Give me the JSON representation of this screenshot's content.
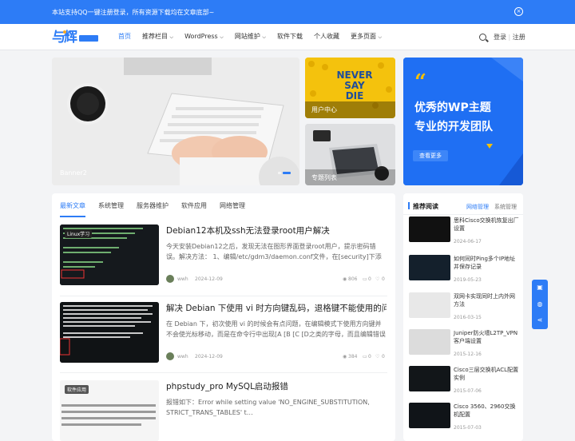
{
  "topbar": {
    "message": "本站支持QQ一键注册登录，所有资源下载均在文章底部~",
    "close_icon": "×"
  },
  "nav": {
    "items": [
      "首页",
      "推荐栏目",
      "WordPress",
      "网站维护",
      "软件下载",
      "个人收藏",
      "更多页面"
    ],
    "login": "登录",
    "register": "注册",
    "separator": "|"
  },
  "slider": {
    "caption": "Banner2"
  },
  "tiles": [
    {
      "caption": "用户中心",
      "poster": [
        "NEVER",
        "SAY",
        "DIE"
      ]
    },
    {
      "caption": "专题列表"
    }
  ],
  "ad": {
    "line1": "优秀的WP主题",
    "line2": "专业的开发团队",
    "button": "查看更多",
    "quote": "“"
  },
  "tabs": [
    "最新文章",
    "系统管理",
    "服务器维护",
    "软件应用",
    "网络管理"
  ],
  "posts": [
    {
      "title": "Debian12本机及ssh无法登录root用户解决",
      "excerpt": "今天安装Debian12之后，发现无法在图形界面登录root用户，提示密码错误。解决方法： 1、编辑/etc/gdm3/daemon.conf文件，在[security]下添加A…",
      "author": "wwh",
      "date": "2024-12-09",
      "views": "806",
      "comments": "0",
      "likes": "0",
      "badge": "Linux学习"
    },
    {
      "title": "解决 Debian 下使用 vi 时方向键乱码，退格键不能使用的问题",
      "excerpt": "在 Debian 下，初次使用 vi 的时候会有点问题，在编辑模式下使用方向键并不会使光标移动，而是在命令行中出现[A [B [C [D之类的字母，而且编辑错误的…",
      "author": "wwh",
      "date": "2024-12-09",
      "views": "384",
      "comments": "0",
      "likes": "0"
    },
    {
      "title": "phpstudy_pro MySQL启动报错",
      "excerpt": "报错如下：Error while setting value  'NO_ENGINE_SUBSTITUTION, STRICT_TRANS_TABLES'  t…",
      "badge": "软件应用"
    }
  ],
  "sidebar": {
    "title": "推荐阅读",
    "tab_active": "网络管理",
    "tab2": "系统管理",
    "items": [
      {
        "title": "思科Cisco交换机恢复出厂设置",
        "date": "2024-06-17"
      },
      {
        "title": "如何同时Ping多个IP地址并保存记录",
        "date": "2019-05-23"
      },
      {
        "title": "双网卡实现同时上内外网方法",
        "date": "2016-03-15"
      },
      {
        "title": "Juniper防火墙L2TP_VPN客户端设置",
        "date": "2015-12-16"
      },
      {
        "title": "Cisco三层交换机ACL配置实例",
        "date": "2015-07-06"
      },
      {
        "title": "Cisco 3560、2960交换机配置",
        "date": "2015-07-03"
      }
    ]
  },
  "colors": {
    "accent": "#2d7cf6"
  }
}
